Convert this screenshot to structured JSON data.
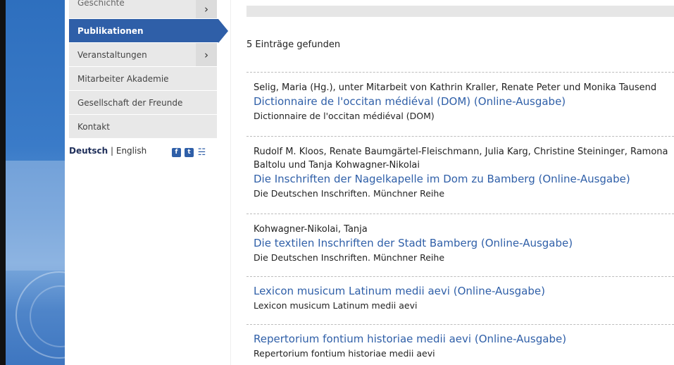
{
  "sidebar": {
    "items": [
      {
        "label": "Geschichte",
        "arrow": "›"
      },
      {
        "label": "Publikationen",
        "active": true
      },
      {
        "label": "Veranstaltungen",
        "arrow": "›"
      },
      {
        "label": "Mitarbeiter Akademie"
      },
      {
        "label": "Gesellschaft der Freunde"
      },
      {
        "label": "Kontakt"
      }
    ],
    "lang_active": "Deutsch",
    "lang_sep": " | ",
    "lang_other": "English",
    "social_icons": [
      "facebook-icon",
      "twitter-icon",
      "rss-icon"
    ]
  },
  "main": {
    "count_text": "5 Einträge gefunden",
    "entries": [
      {
        "authors": "Selig, Maria (Hg.), unter Mitarbeit von Kathrin Kraller, Renate Peter und Monika Tausend",
        "title": "Dictionnaire de l'occitan médiéval (DOM) (Online-Ausgabe)",
        "series": "Dictionnaire de l'occitan médiéval (DOM)"
      },
      {
        "authors": "Rudolf M. Kloos, Renate Baumgärtel-Fleischmann, Julia Karg, Christine Steininger, Ramona Baltolu und Tanja Kohwagner-Nikolai",
        "title": "Die Inschriften der Nagelkapelle im Dom zu Bamberg (Online-Ausgabe)",
        "series": "Die Deutschen Inschriften. Münchner Reihe"
      },
      {
        "authors": "Kohwagner-Nikolai, Tanja",
        "title": "Die textilen Inschriften der Stadt Bamberg (Online-Ausgabe)",
        "series": "Die Deutschen Inschriften. Münchner Reihe"
      },
      {
        "authors": "",
        "title": "Lexicon musicum Latinum medii aevi (Online-Ausgabe)",
        "series": "Lexicon musicum Latinum medii aevi"
      },
      {
        "authors": "",
        "title": "Repertorium fontium historiae medii aevi (Online-Ausgabe)",
        "series": "Repertorium fontium historiae medii aevi"
      }
    ]
  },
  "colors": {
    "accent": "#2f5fa8",
    "nav_bg": "#e8e8e8",
    "band_blue": "#3a7bc8"
  }
}
